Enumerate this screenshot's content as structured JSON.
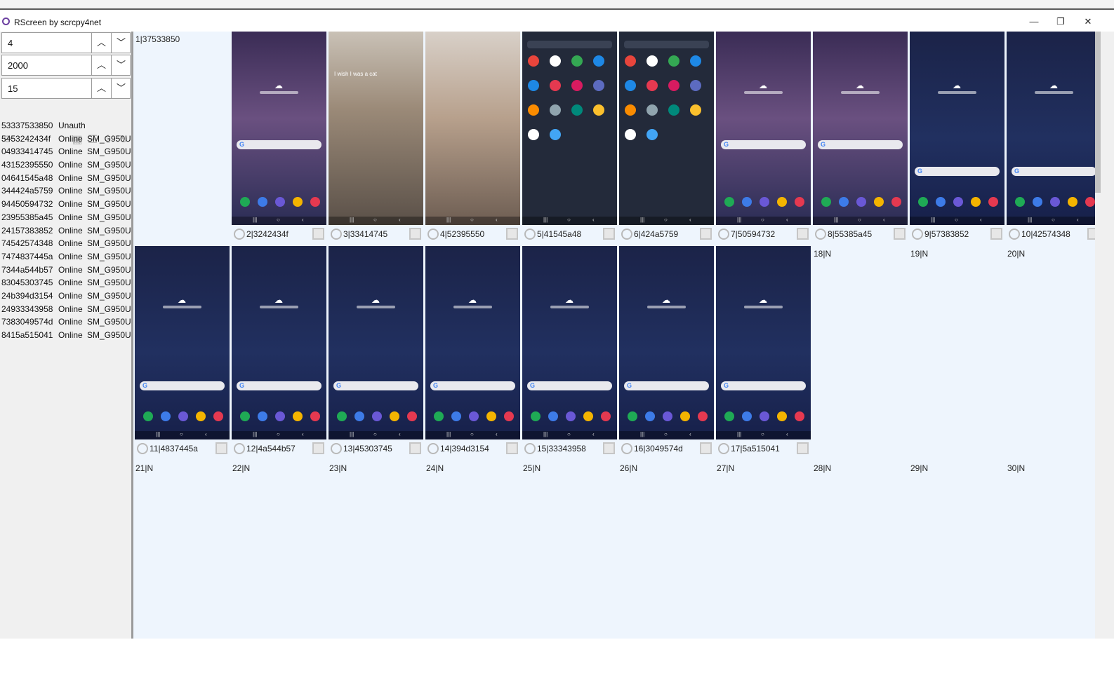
{
  "window": {
    "title": "RScreen by scrcpy4net"
  },
  "controls": {
    "spin1": "4",
    "spin2": "2000",
    "spin3": "15"
  },
  "devices": [
    {
      "serial": "53337533850",
      "status": "Unauth",
      "model": ""
    },
    {
      "serial": "5453242434f",
      "status": "Online",
      "model": "SM_G950U"
    },
    {
      "serial": "04933414745",
      "status": "Online",
      "model": "SM_G950U"
    },
    {
      "serial": "43152395550",
      "status": "Online",
      "model": "SM_G950U"
    },
    {
      "serial": "04641545a48",
      "status": "Online",
      "model": "SM_G950U"
    },
    {
      "serial": "344424a5759",
      "status": "Online",
      "model": "SM_G950U"
    },
    {
      "serial": "94450594732",
      "status": "Online",
      "model": "SM_G950U"
    },
    {
      "serial": "23955385a45",
      "status": "Online",
      "model": "SM_G950U"
    },
    {
      "serial": "24157383852",
      "status": "Online",
      "model": "SM_G950U"
    },
    {
      "serial": "74542574348",
      "status": "Online",
      "model": "SM_G950U"
    },
    {
      "serial": "7474837445a",
      "status": "Online",
      "model": "SM_G950U"
    },
    {
      "serial": "7344a544b57",
      "status": "Online",
      "model": "SM_G950U"
    },
    {
      "serial": "83045303745",
      "status": "Online",
      "model": "SM_G950U"
    },
    {
      "serial": "24b394d3154",
      "status": "Online",
      "model": "SM_G950U"
    },
    {
      "serial": "24933343958",
      "status": "Online",
      "model": "SM_G950U"
    },
    {
      "serial": "7383049574d",
      "status": "Online",
      "model": "SM_G950U"
    },
    {
      "serial": "8415a515041",
      "status": "Online",
      "model": "SM_G950U"
    }
  ],
  "cells": [
    {
      "label": "1|37533850",
      "kind": "empty"
    },
    {
      "label": "2|3242434f",
      "kind": "home2"
    },
    {
      "label": "3|33414745",
      "kind": "photo1",
      "caption": "I wish I was a cat"
    },
    {
      "label": "4|52395550",
      "kind": "photo2"
    },
    {
      "label": "5|41545a48",
      "kind": "apps"
    },
    {
      "label": "6|424a5759",
      "kind": "apps"
    },
    {
      "label": "7|50594732",
      "kind": "home2"
    },
    {
      "label": "8|55385a45",
      "kind": "home2"
    },
    {
      "label": "9|57383852",
      "kind": "home"
    },
    {
      "label": "10|42574348",
      "kind": "home"
    },
    {
      "label": "11|4837445a",
      "kind": "home"
    },
    {
      "label": "12|4a544b57",
      "kind": "home"
    },
    {
      "label": "13|45303745",
      "kind": "home"
    },
    {
      "label": "14|394d3154",
      "kind": "home"
    },
    {
      "label": "15|33343958",
      "kind": "home"
    },
    {
      "label": "16|3049574d",
      "kind": "home"
    },
    {
      "label": "17|5a515041",
      "kind": "home"
    },
    {
      "label": "18|N",
      "kind": "empty"
    },
    {
      "label": "19|N",
      "kind": "empty"
    },
    {
      "label": "20|N",
      "kind": "empty"
    },
    {
      "label": "21|N",
      "kind": "empty"
    },
    {
      "label": "22|N",
      "kind": "empty"
    },
    {
      "label": "23|N",
      "kind": "empty"
    },
    {
      "label": "24|N",
      "kind": "empty"
    },
    {
      "label": "25|N",
      "kind": "empty"
    },
    {
      "label": "26|N",
      "kind": "empty"
    },
    {
      "label": "27|N",
      "kind": "empty"
    },
    {
      "label": "28|N",
      "kind": "empty"
    },
    {
      "label": "29|N",
      "kind": "empty"
    },
    {
      "label": "30|N",
      "kind": "empty"
    }
  ],
  "icons": {
    "app": "purple-ring-icon",
    "minimize": "minimize-icon",
    "restore": "restore-icon",
    "close": "close-icon",
    "up": "chevron-up-icon",
    "down": "chevron-down-icon",
    "refresh": "refresh-icon",
    "grid": "grid-view-icon",
    "list": "list-view-icon",
    "upload": "upload-icon",
    "rotate": "rotate-icon",
    "cell_rotate": "rotate-screen-icon",
    "cell_expand": "expand-icon"
  },
  "colors": {
    "grid_bg": "#eef5fd",
    "sidebar_bg": "#f0f0f0"
  }
}
